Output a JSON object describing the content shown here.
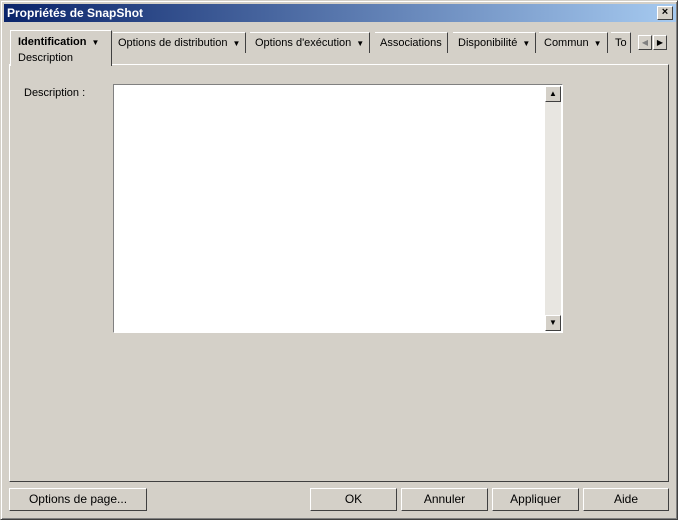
{
  "window": {
    "title": "Propriétés de SnapShot",
    "close": "✕"
  },
  "tabs": [
    {
      "label": "Identification",
      "sub": "Description"
    },
    {
      "label": "Options de distribution"
    },
    {
      "label": "Options d'exécution"
    },
    {
      "label": "Associations"
    },
    {
      "label": "Disponibilité"
    },
    {
      "label": "Commun"
    },
    {
      "label": "To"
    }
  ],
  "form": {
    "description_label": "Description :",
    "description_value": ""
  },
  "buttons": {
    "page_options": "Options de page...",
    "ok": "OK",
    "cancel": "Annuler",
    "apply": "Appliquer",
    "help": "Aide"
  }
}
